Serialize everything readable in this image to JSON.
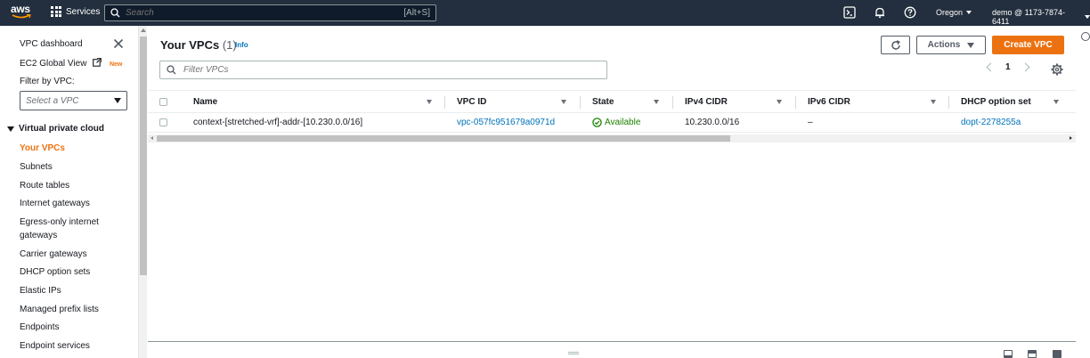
{
  "topnav": {
    "logo_text": "aws",
    "services_label": "Services",
    "search_placeholder": "Search",
    "search_shortcut": "[Alt+S]",
    "region": "Oregon",
    "account": "demo @ 1173-7874-6411"
  },
  "sidebar": {
    "vpc_dashboard": "VPC dashboard",
    "ec2_global_view": "EC2 Global View",
    "new_badge": "New",
    "filter_label": "Filter by VPC:",
    "filter_placeholder": "Select a VPC",
    "section_title": "Virtual private cloud",
    "items": [
      {
        "label": "Your VPCs",
        "active": true
      },
      {
        "label": "Subnets"
      },
      {
        "label": "Route tables"
      },
      {
        "label": "Internet gateways"
      },
      {
        "label": "Egress-only internet"
      },
      {
        "label": "gateways"
      },
      {
        "label": "Carrier gateways"
      },
      {
        "label": "DHCP option sets"
      },
      {
        "label": "Elastic IPs"
      },
      {
        "label": "Managed prefix lists"
      },
      {
        "label": "Endpoints"
      },
      {
        "label": "Endpoint services"
      }
    ]
  },
  "main": {
    "title": "Your VPCs",
    "count": "(1)",
    "info": "Info",
    "actions_label": "Actions",
    "create_label": "Create VPC",
    "filter_placeholder": "Filter VPCs",
    "page_number": "1",
    "columns": [
      "Name",
      "VPC ID",
      "State",
      "IPv4 CIDR",
      "IPv6 CIDR",
      "DHCP option set"
    ],
    "rows": [
      {
        "name": "context-[stretched-vrf]-addr-[10.230.0.0/16]",
        "vpc_id": "vpc-057fc951679a0971d",
        "state": "Available",
        "ipv4": "10.230.0.0/16",
        "ipv6": "–",
        "dhcp": "dopt-2278255a"
      }
    ]
  },
  "colors": {
    "nav_bg": "#232f3e",
    "accent_orange": "#ec7211",
    "link_blue": "#0073bb",
    "status_green": "#1d8102"
  }
}
